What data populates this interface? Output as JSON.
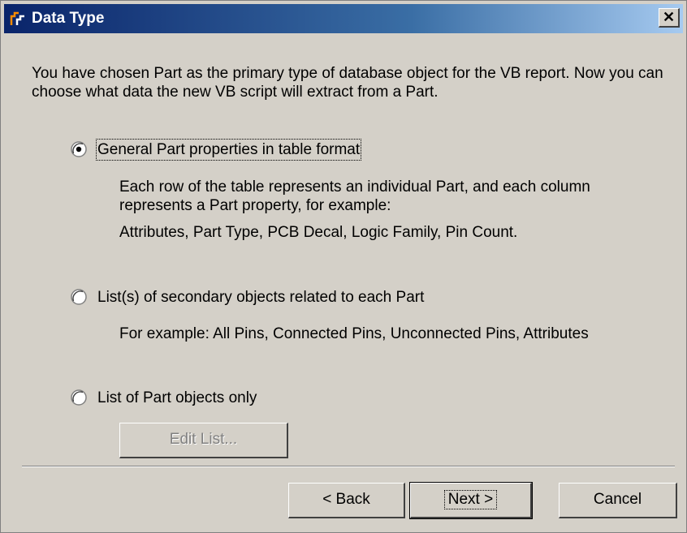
{
  "window": {
    "title": "Data Type",
    "close_glyph": "✕",
    "icon": "app-logo-icon"
  },
  "intro_text": "You have chosen Part as the primary type of database object for the VB report. Now you can choose what data the new VB script will extract from a Part.",
  "options": [
    {
      "label": "General Part properties in table format",
      "selected": true,
      "description_lines": [
        "Each row of the table represents an individual Part, and each column",
        "represents a Part property, for example:",
        "Attributes, Part Type, PCB Decal, Logic Family, Pin Count."
      ]
    },
    {
      "label": "List(s) of secondary objects related to each Part",
      "selected": false,
      "description_lines": [
        "For example: All Pins, Connected Pins, Unconnected Pins, Attributes"
      ]
    },
    {
      "label": "List of Part objects only",
      "selected": false
    }
  ],
  "edit_list_button": {
    "label": "Edit List...",
    "enabled": false
  },
  "buttons": {
    "back": "< Back",
    "next": "Next >",
    "cancel": "Cancel"
  }
}
